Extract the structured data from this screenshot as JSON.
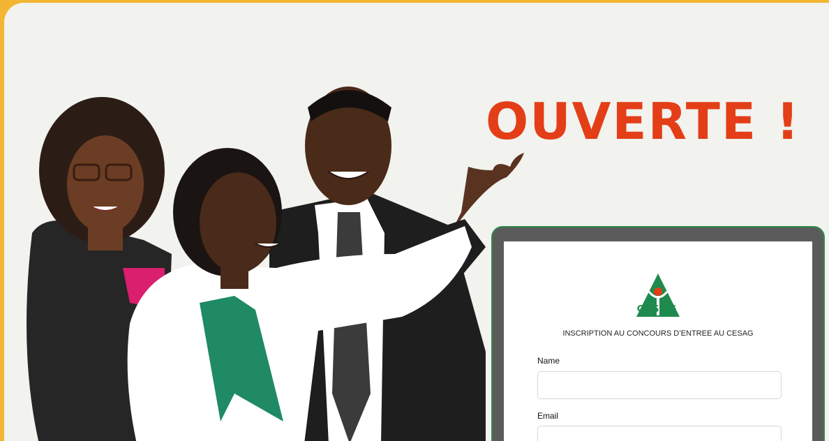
{
  "headline": "OUVERTE !",
  "form": {
    "brand": "CESAG",
    "title": "INSCRIPTION AU CONCOURS D’ENTREE AU CESAG",
    "fields": [
      {
        "label": "Name",
        "value": ""
      },
      {
        "label": "Email",
        "value": ""
      }
    ]
  },
  "colors": {
    "background": "#f2f2ee",
    "border": "#f2b632",
    "headline": "#e33e17",
    "brand_green": "#1f8a4d"
  }
}
